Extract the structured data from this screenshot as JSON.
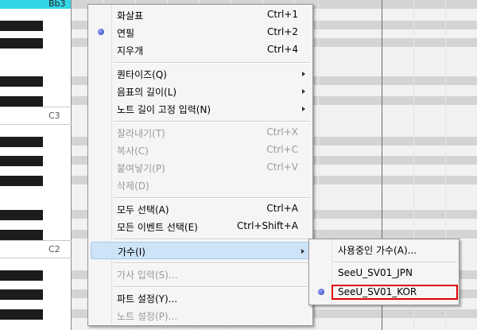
{
  "piano": {
    "highlight_label": "Bb3",
    "labels": {
      "c3": "C3",
      "c2": "C2"
    }
  },
  "context_menu": {
    "arrow": "화살표",
    "arrow_shortcut": "Ctrl+1",
    "pencil": "연필",
    "pencil_shortcut": "Ctrl+2",
    "eraser": "지우개",
    "eraser_shortcut": "Ctrl+4",
    "quantize": "퀀타이즈(Q)",
    "note_length": "음표의 길이(L)",
    "fixed_length_input": "노트 길이 고정 입력(N)",
    "cut": "잘라내기(T)",
    "cut_shortcut": "Ctrl+X",
    "copy": "복사(C)",
    "copy_shortcut": "Ctrl+C",
    "paste": "붙여넣기(P)",
    "paste_shortcut": "Ctrl+V",
    "delete": "삭제(D)",
    "select_all": "모두 선택(A)",
    "select_all_shortcut": "Ctrl+A",
    "select_all_events": "모든 이벤트 선택(E)",
    "select_all_events_shortcut": "Ctrl+Shift+A",
    "singer": "가수(I)",
    "lyrics_input": "가사 입력(S)...",
    "part_settings": "파트 설정(Y)...",
    "note_settings": "노트 설정(P)..."
  },
  "singer_menu": {
    "singer_in_use": "사용중인 가수(A)...",
    "jpn": "SeeU_SV01_JPN",
    "kor": "SeeU_SV01_KOR"
  },
  "colors": {
    "highlight_key": "#33d6e6",
    "menu_hover": "#cde3f7",
    "annotation_box": "#e00000"
  }
}
